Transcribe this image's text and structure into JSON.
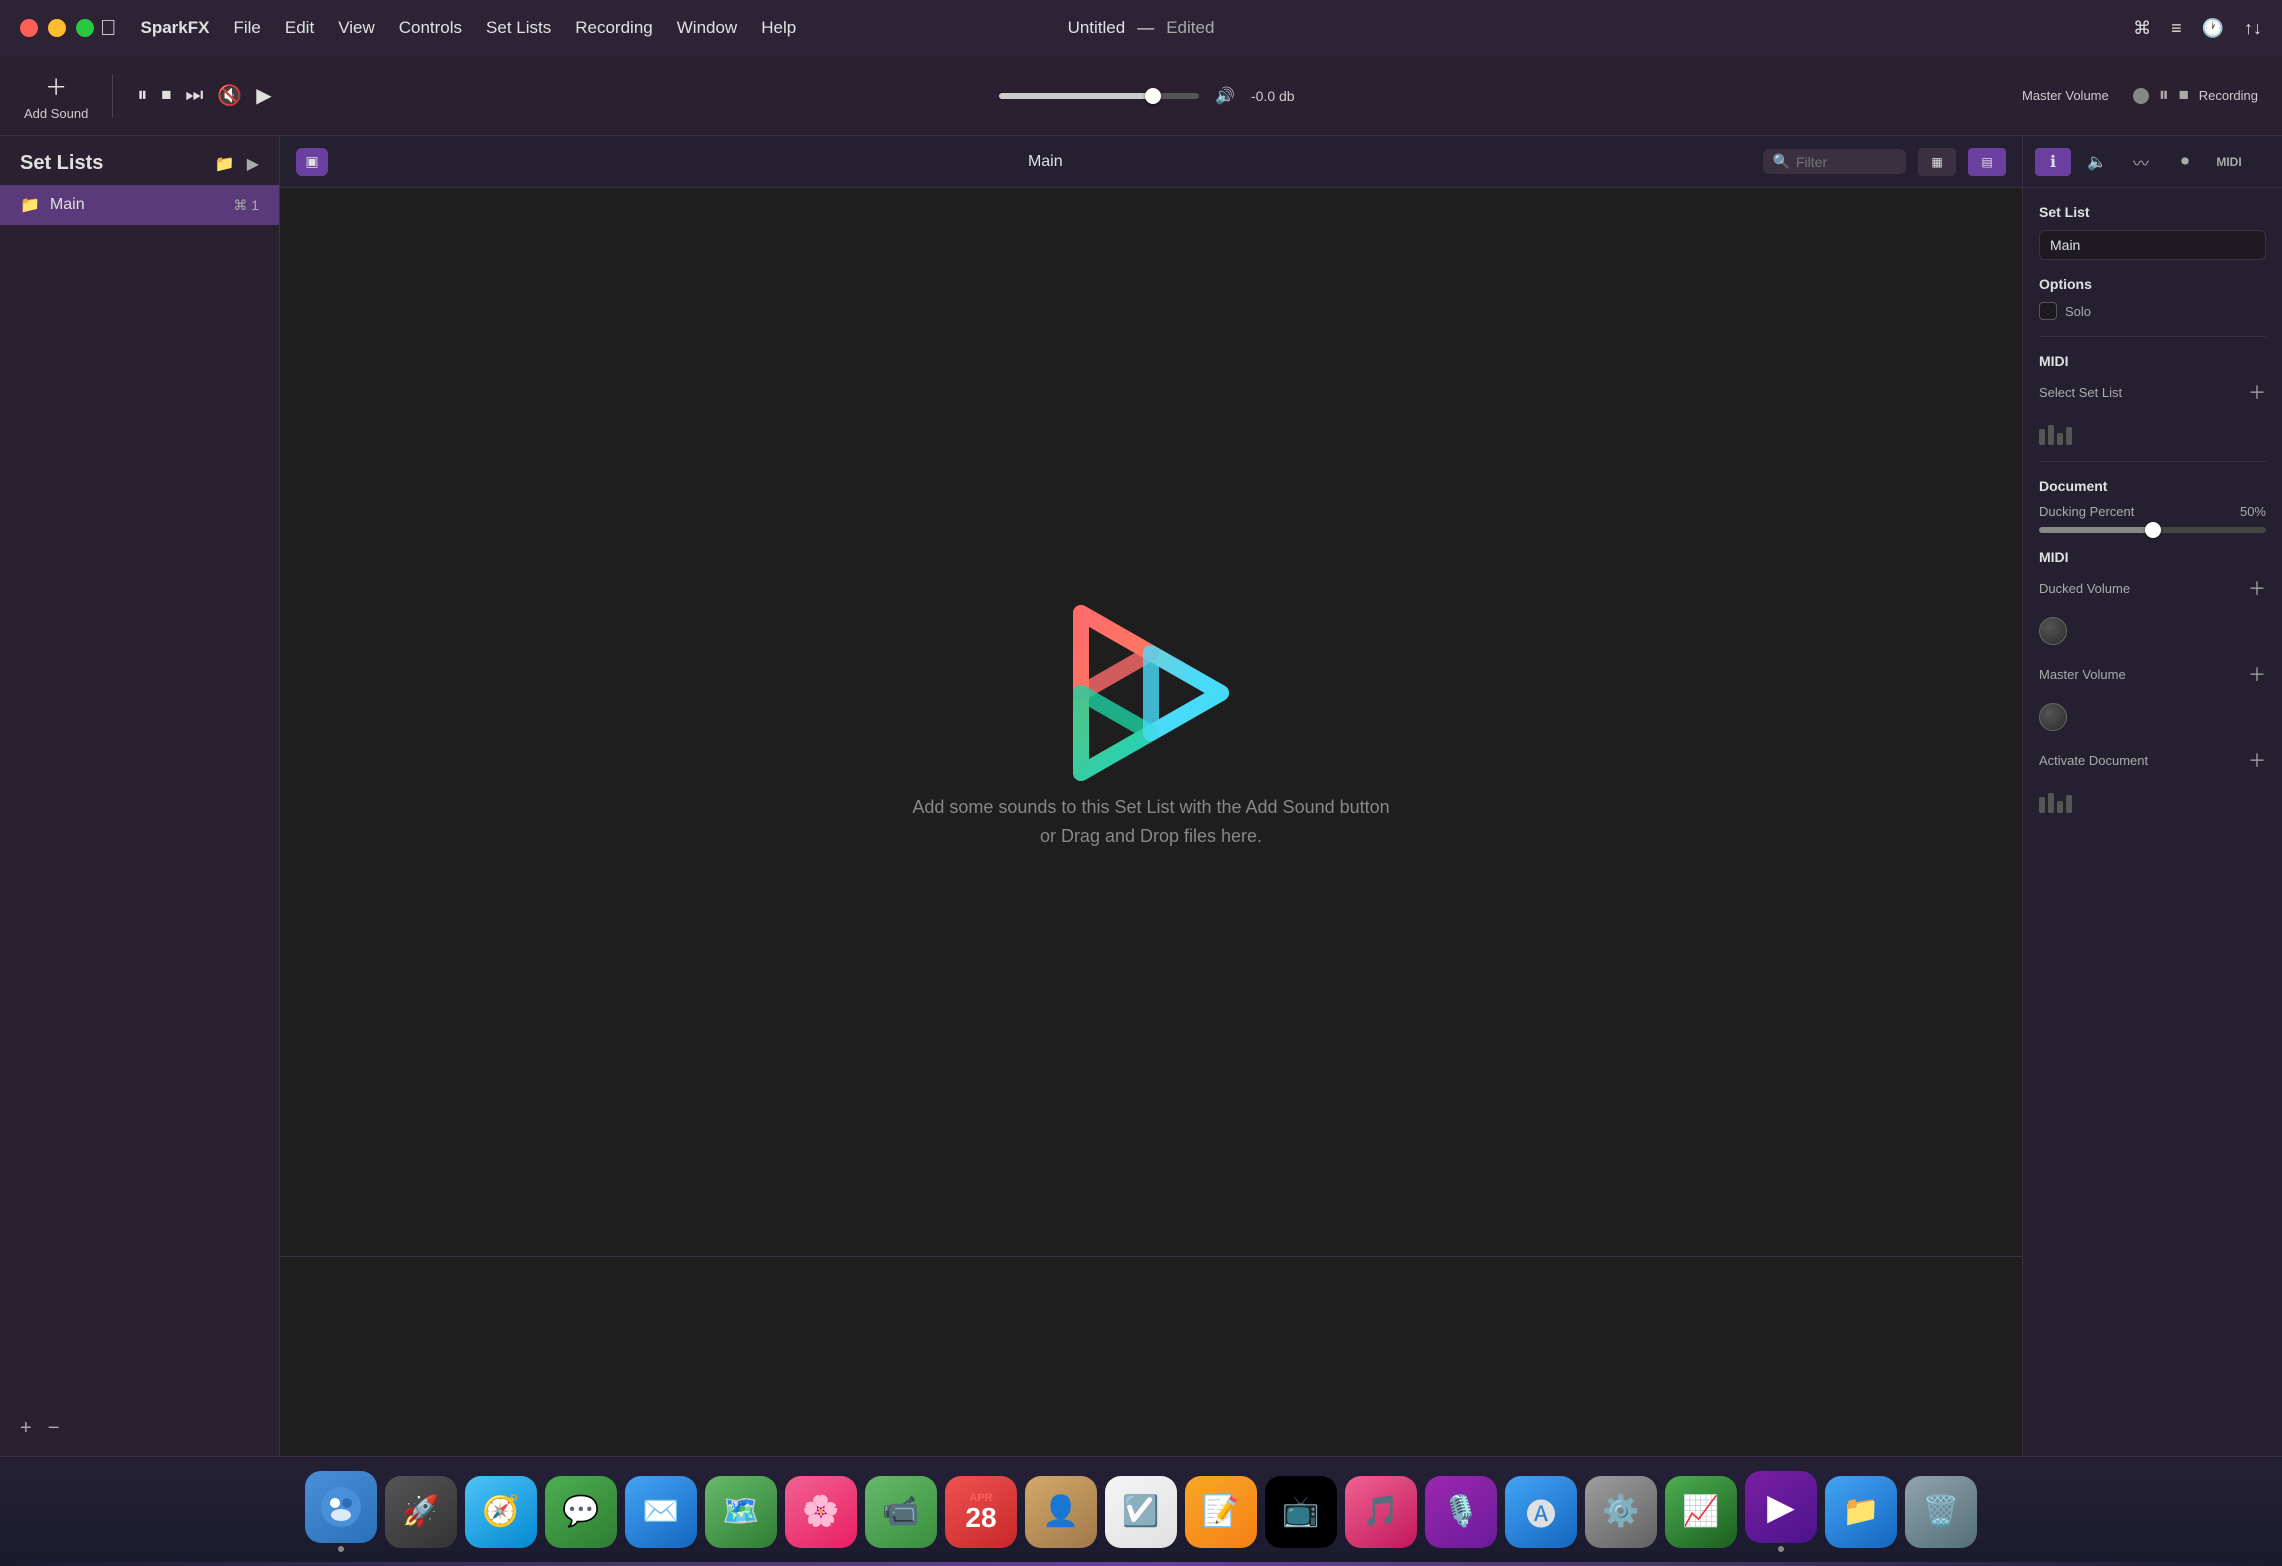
{
  "menubar": {
    "apple": "",
    "app_name": "SparkFX",
    "menus": [
      "File",
      "Edit",
      "View",
      "Controls",
      "Set Lists",
      "Recording",
      "Window",
      "Help"
    ],
    "title": "Untitled",
    "separator": "—",
    "edited": "Edited"
  },
  "toolbar": {
    "add_sound": "Add Sound",
    "playback": "Playback",
    "master_volume": "Master Volume",
    "volume_db": "-0.0 db",
    "recording": "Recording"
  },
  "sidebar": {
    "title": "Set Lists",
    "items": [
      {
        "label": "Main",
        "shortcut": "⌘ 1"
      }
    ],
    "add_btn": "+",
    "remove_btn": "−"
  },
  "content": {
    "tab_label": "Main",
    "filter_placeholder": "Filter",
    "placeholder_line1": "Add some sounds to this Set List with the Add Sound button",
    "placeholder_line2": "or Drag and Drop files here."
  },
  "right_panel": {
    "tabs": [
      "info",
      "volume",
      "eq",
      "record",
      "midi"
    ],
    "set_list_label": "Set List",
    "set_list_value": "Main",
    "options_label": "Options",
    "solo_label": "Solo",
    "midi_label": "MIDI",
    "select_set_list_label": "Select Set List",
    "document_label": "Document",
    "ducking_percent_label": "Ducking Percent",
    "ducking_value": "50%",
    "midi_label2": "MIDI",
    "ducked_volume_label": "Ducked Volume",
    "master_volume_label": "Master Volume",
    "activate_document_label": "Activate Document"
  },
  "dock": {
    "apps": [
      {
        "name": "Finder",
        "emoji": "🔵",
        "class": "app-finder"
      },
      {
        "name": "Launchpad",
        "emoji": "🚀",
        "class": "app-launchpad"
      },
      {
        "name": "Safari",
        "emoji": "🧭",
        "class": "app-safari"
      },
      {
        "name": "Messages",
        "emoji": "💬",
        "class": "app-messages"
      },
      {
        "name": "Mail",
        "emoji": "✉️",
        "class": "app-mail"
      },
      {
        "name": "Maps",
        "emoji": "🗺️",
        "class": "app-maps"
      },
      {
        "name": "Photos",
        "emoji": "🌸",
        "class": "app-photos"
      },
      {
        "name": "FaceTime",
        "emoji": "📹",
        "class": "app-facetime"
      },
      {
        "name": "Calendar",
        "emoji": "28",
        "class": "app-calendar"
      },
      {
        "name": "Contacts",
        "emoji": "👤",
        "class": "app-contacts"
      },
      {
        "name": "Reminders",
        "emoji": "☑️",
        "class": "app-reminders"
      },
      {
        "name": "Notes",
        "emoji": "📝",
        "class": "app-notes"
      },
      {
        "name": "Apple TV",
        "emoji": "📺",
        "class": "app-appletv"
      },
      {
        "name": "Music",
        "emoji": "🎵",
        "class": "app-music"
      },
      {
        "name": "Podcasts",
        "emoji": "🎙️",
        "class": "app-podcasts"
      },
      {
        "name": "App Store",
        "emoji": "🅐",
        "class": "app-appstore"
      },
      {
        "name": "System Preferences",
        "emoji": "⚙️",
        "class": "app-settings"
      },
      {
        "name": "Stocks",
        "emoji": "📈",
        "class": "app-stocks"
      },
      {
        "name": "SparkFX",
        "emoji": "▶",
        "class": "app-sparkfx"
      },
      {
        "name": "Files",
        "emoji": "📁",
        "class": "app-files"
      },
      {
        "name": "Trash",
        "emoji": "🗑️",
        "class": "app-trash"
      }
    ]
  },
  "icons": {
    "play": "▶",
    "pause": "⏸",
    "stop": "⏹",
    "skip": "⏭",
    "mute": "🔇",
    "volume": "🔊",
    "add": "+",
    "folder": "📁",
    "play_small": "▶"
  }
}
